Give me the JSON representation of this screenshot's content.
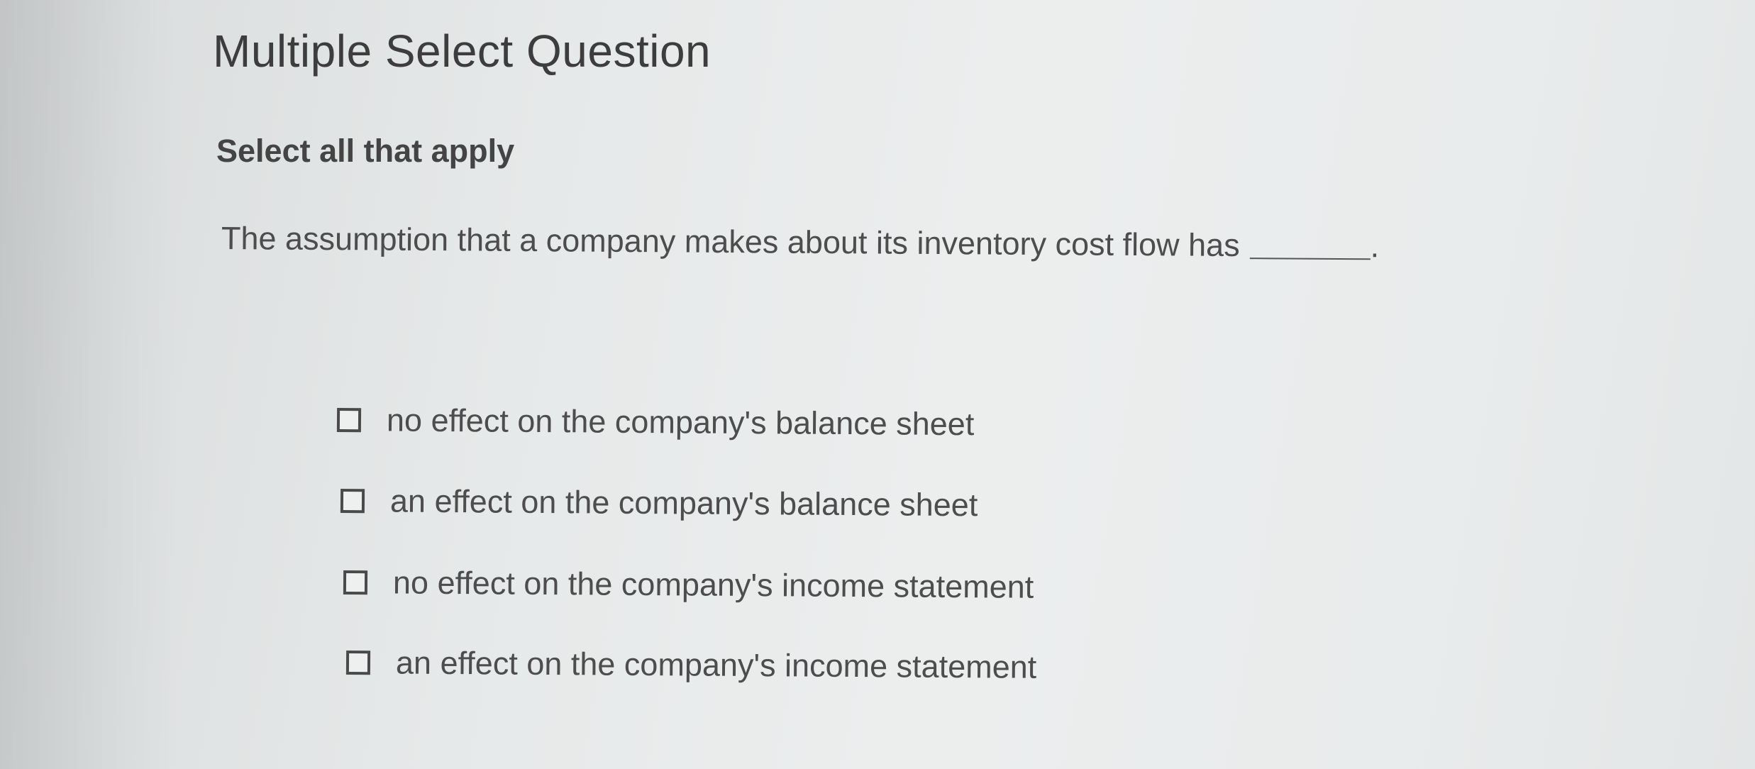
{
  "question": {
    "type_title": "Multiple Select Question",
    "instruction": "Select all that apply",
    "prompt_text": "The assumption that a company makes about its inventory cost flow has",
    "prompt_end": "."
  },
  "options": [
    {
      "label": "no effect on the company's balance sheet",
      "checked": false
    },
    {
      "label": "an effect on the company's balance sheet",
      "checked": false
    },
    {
      "label": "no effect on the company's income statement",
      "checked": false
    },
    {
      "label": "an effect on the company's income statement",
      "checked": false
    }
  ]
}
